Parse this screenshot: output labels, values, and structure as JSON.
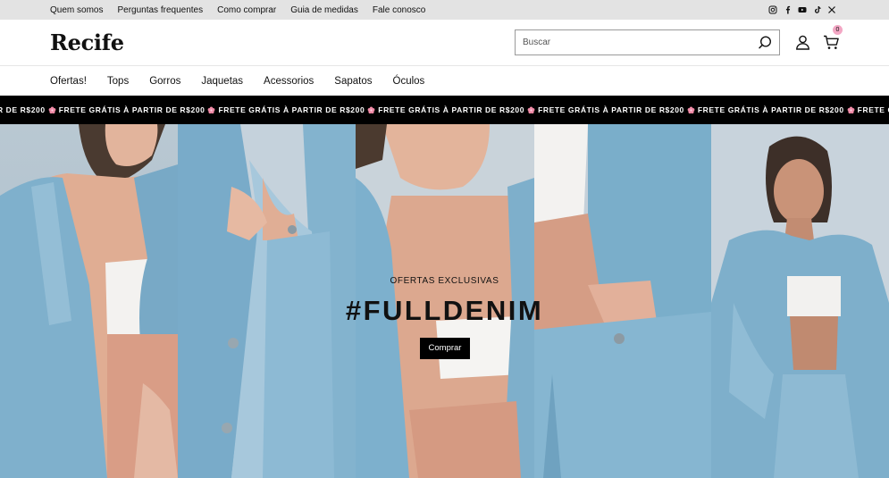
{
  "topbar": {
    "links": [
      "Quem somos",
      "Perguntas frequentes",
      "Como comprar",
      "Guia de medidas",
      "Fale conosco"
    ],
    "social_icons": [
      "instagram-icon",
      "facebook-icon",
      "youtube-icon",
      "tiktok-icon",
      "x-icon"
    ]
  },
  "header": {
    "logo": "Recife",
    "search_placeholder": "Buscar",
    "cart_count": "0"
  },
  "nav": {
    "items": [
      "Ofertas!",
      "Tops",
      "Gorros",
      "Jaquetas",
      "Acessorios",
      "Sapatos",
      "Óculos"
    ]
  },
  "marquee": {
    "text": "FRETE GRÁTIS À PARTIR DE R$200",
    "leading_fragment": "IR DE R$200",
    "separator_icon": "flower-icon",
    "flower_color": "#f08aa6"
  },
  "hero": {
    "kicker": "OFERTAS EXCLUSIVAS",
    "headline": "#FULLDENIM",
    "cta_label": "Comprar"
  },
  "colors": {
    "topbar_bg": "#e3e3e3",
    "marquee_bg": "#000000",
    "cart_badge": "#f3a7c4",
    "denim": "#7fb0cc"
  }
}
